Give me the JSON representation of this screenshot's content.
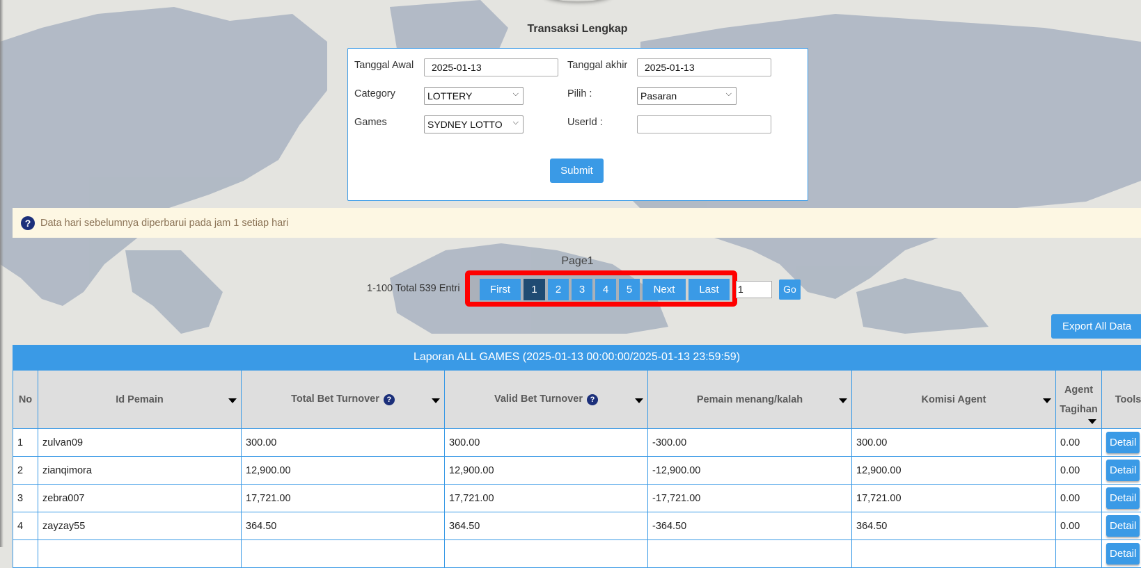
{
  "page": {
    "title": "Transaksi Lengkap"
  },
  "filters": {
    "start_date_label": "Tanggal Awal",
    "start_date_value": "2025-01-13",
    "end_date_label": "Tanggal akhir",
    "end_date_value": "2025-01-13",
    "category_label": "Category",
    "category_value": "LOTTERY",
    "pilih_label": "Pilih  :",
    "pilih_value": "Pasaran",
    "games_label": "Games",
    "games_value": "SYDNEY LOTTO",
    "userid_label": "UserId  :",
    "userid_value": "",
    "submit_label": "Submit"
  },
  "notice": {
    "icon": "question-circle-icon",
    "text": "Data hari sebelumnya diperbarui pada jam 1 setiap hari"
  },
  "pagination": {
    "page_label": "Page1",
    "range_text": "1-100 Total 539 Entri",
    "first_label": "First",
    "pages": [
      "1",
      "2",
      "3",
      "4",
      "5"
    ],
    "active_page": "1",
    "next_label": "Next",
    "last_label": "Last",
    "goto_value": "1",
    "go_label": "Go"
  },
  "export": {
    "label": "Export All Data"
  },
  "report": {
    "caption": "Laporan ALL GAMES (2025-01-13 00:00:00/2025-01-13 23:59:59)",
    "columns": {
      "no": "No",
      "player_id": "Id Pemain",
      "total_bet": "Total Bet Turnover",
      "valid_bet": "Valid Bet Turnover",
      "win_loss": "Pemain menang/kalah",
      "commission": "Komisi Agent",
      "agent_bill": "Agent Tagihan",
      "tools": "Tools"
    },
    "detail_label": "Detail",
    "rows": [
      {
        "no": "1",
        "player_id": "zulvan09",
        "total_bet": "300.00",
        "valid_bet": "300.00",
        "win_loss": "-300.00",
        "commission": "300.00",
        "agent_bill": "0.00"
      },
      {
        "no": "2",
        "player_id": "zianqimora",
        "total_bet": "12,900.00",
        "valid_bet": "12,900.00",
        "win_loss": "-12,900.00",
        "commission": "12,900.00",
        "agent_bill": "0.00"
      },
      {
        "no": "3",
        "player_id": "zebra007",
        "total_bet": "17,721.00",
        "valid_bet": "17,721.00",
        "win_loss": "-17,721.00",
        "commission": "17,721.00",
        "agent_bill": "0.00"
      },
      {
        "no": "4",
        "player_id": "zayzay55",
        "total_bet": "364.50",
        "valid_bet": "364.50",
        "win_loss": "-364.50",
        "commission": "364.50",
        "agent_bill": "0.00"
      },
      {
        "no": "",
        "player_id": "",
        "total_bet": "",
        "valid_bet": "",
        "win_loss": "",
        "commission": "",
        "agent_bill": ""
      }
    ]
  },
  "colors": {
    "accent": "#3a9ae6",
    "active_page": "#1f4b73",
    "negative": "#e60000",
    "positive": "#118811",
    "highlight": "#ff0000"
  }
}
